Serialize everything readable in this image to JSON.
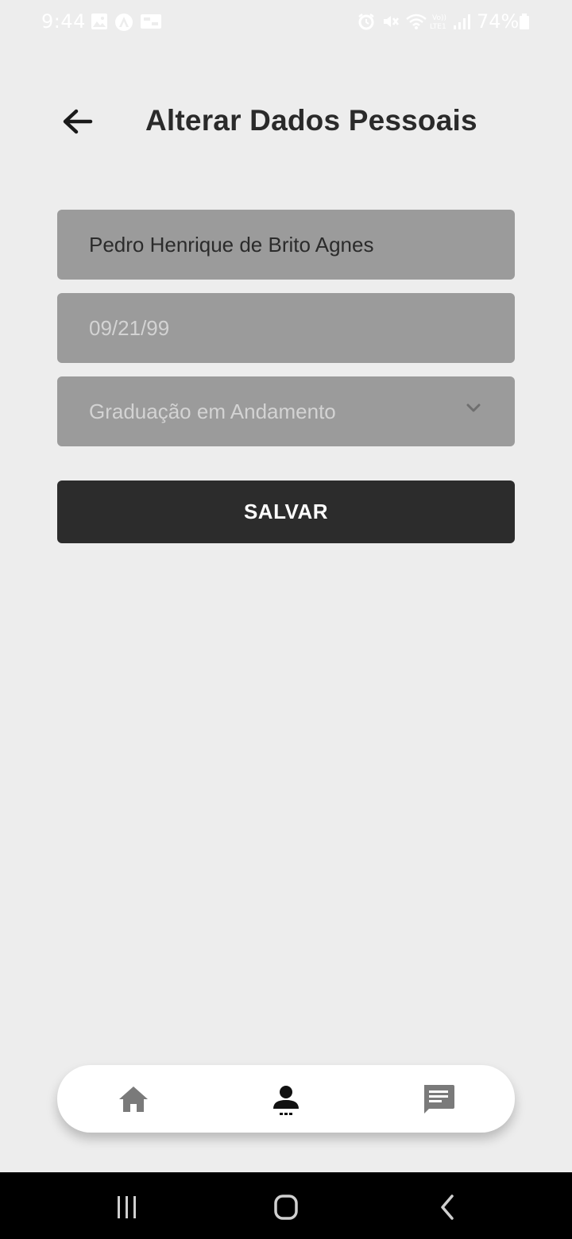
{
  "status_bar": {
    "time": "9:44",
    "battery": "74%",
    "icons": [
      "gallery-icon",
      "app-notification-icon",
      "screen-record-icon",
      "alarm-icon",
      "mute-icon",
      "wifi-icon",
      "volte-icon",
      "signal-icon",
      "battery-icon"
    ]
  },
  "header": {
    "title": "Alterar Dados Pessoais",
    "back_icon": "arrow-left-icon"
  },
  "form": {
    "name_value": "Pedro Henrique de Brito Agnes",
    "date_placeholder": "09/21/99",
    "education_selected": "Graduação em Andamento",
    "save_label": "SALVAR"
  },
  "tab_bar": {
    "tabs": [
      {
        "icon": "home-icon",
        "active": false
      },
      {
        "icon": "person-icon",
        "active": true
      },
      {
        "icon": "chat-icon",
        "active": false
      }
    ],
    "active_color": "#111111",
    "inactive_color": "#7a7a7a"
  },
  "nav_bar": {
    "buttons": [
      "recents-icon",
      "home-button-icon",
      "back-icon"
    ]
  },
  "colors": {
    "background": "#ededed",
    "field": "#9b9b9b",
    "button": "#2c2c2c"
  }
}
